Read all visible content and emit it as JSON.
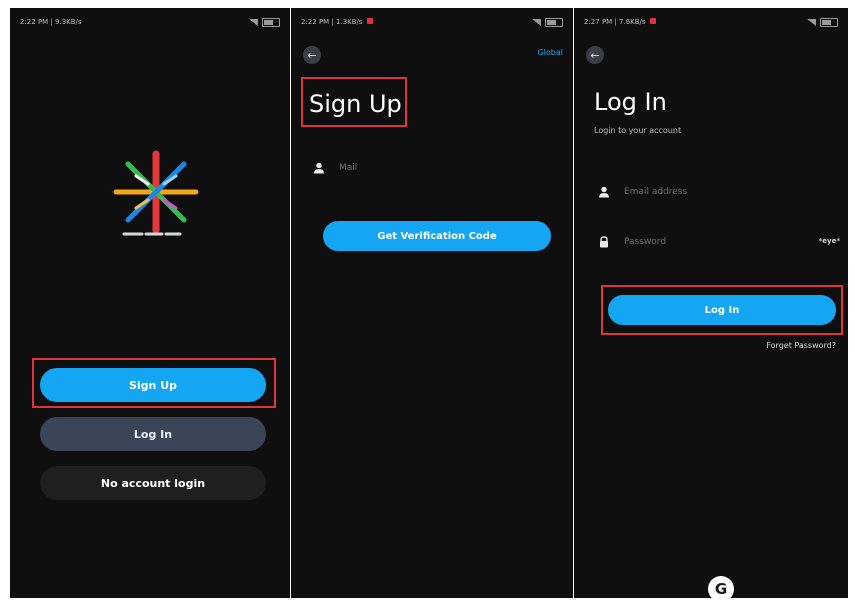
{
  "screens": {
    "welcome": {
      "status_time": "2:22 PM | 9.3KB/s",
      "signup_label": "Sign Up",
      "login_label": "Log In",
      "no_account_label": "No account login"
    },
    "signup": {
      "status_time": "2:22 PM | 1.3KB/s",
      "global_label": "Global",
      "title": "Sign Up",
      "mail_placeholder": "Mail",
      "verify_label": "Get Verification Code"
    },
    "login": {
      "status_time": "2:27 PM | 7.6KB/s",
      "title": "Log In",
      "subtitle": "Login to your account",
      "email_placeholder": "Email address",
      "password_placeholder": "Password",
      "password_toggle": "*eye*",
      "login_label": "Log In",
      "forgot_label": "Forget Password?",
      "google_label": "G"
    }
  },
  "colors": {
    "accent": "#14a5f3",
    "highlight": "#e0343a",
    "background": "#0f0f0f"
  }
}
